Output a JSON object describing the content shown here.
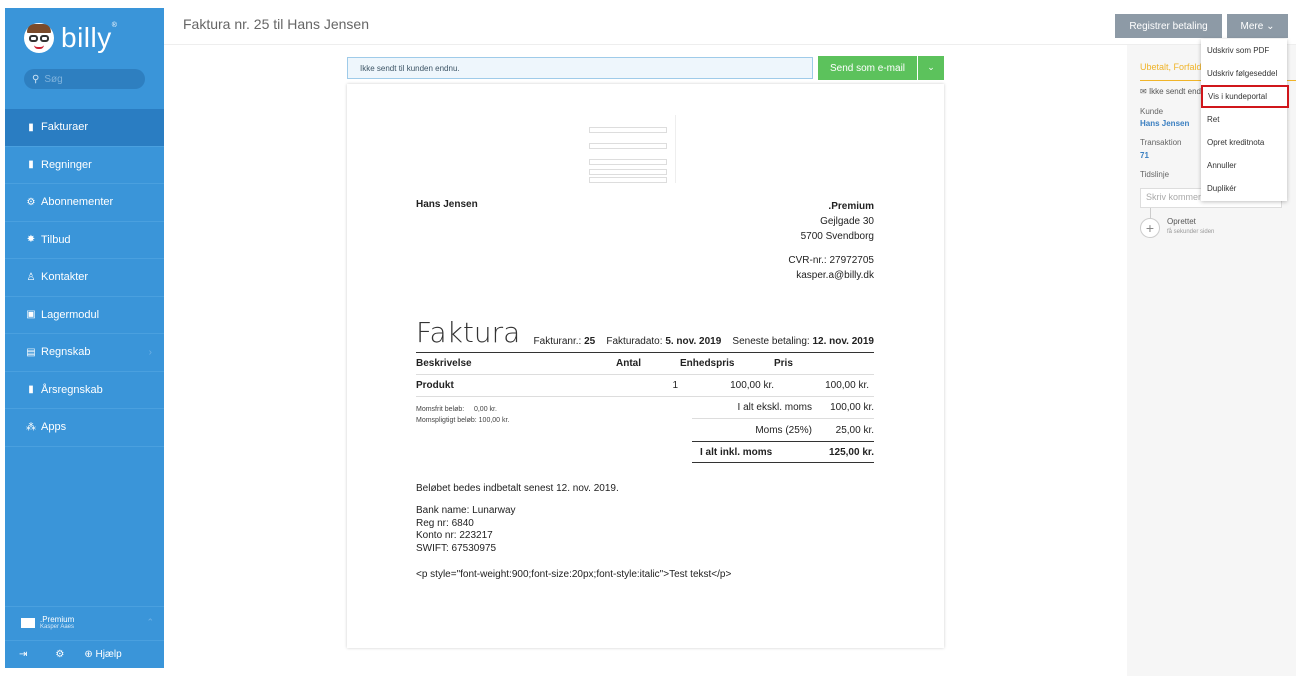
{
  "sidebar": {
    "logo": "billy",
    "logo_mark": "®",
    "search_placeholder": "Søg",
    "items": [
      {
        "label": "Fakturaer",
        "icon": "invoice-icon",
        "glyph": "▮"
      },
      {
        "label": "Regninger",
        "icon": "bill-icon",
        "glyph": "▮"
      },
      {
        "label": "Abonnementer",
        "icon": "subscription-icon",
        "glyph": "⚙"
      },
      {
        "label": "Tilbud",
        "icon": "quote-icon",
        "glyph": "✸"
      },
      {
        "label": "Kontakter",
        "icon": "contacts-icon",
        "glyph": "♙"
      },
      {
        "label": "Lagermodul",
        "icon": "inventory-icon",
        "glyph": "▣"
      },
      {
        "label": "Regnskab",
        "icon": "accounting-icon",
        "glyph": "▤"
      },
      {
        "label": "Årsregnskab",
        "icon": "annual-report-icon",
        "glyph": "▮"
      },
      {
        "label": "Apps",
        "icon": "apps-icon",
        "glyph": "⁂"
      }
    ],
    "org_name": ".Premium",
    "org_user": "Kasper Aaes",
    "help": "Hjælp"
  },
  "header": {
    "title": "Faktura nr. 25 til Hans Jensen",
    "register_payment": "Registrer betaling",
    "more": "Mere"
  },
  "notice": "Ikke sendt til kunden endnu.",
  "send_email": "Send som e-mail",
  "invoice": {
    "customer": "Hans Jensen",
    "company": {
      "name": ".Premium",
      "street": "Gejlgade 30",
      "city": "5700 Svendborg",
      "cvr": "CVR-nr.: 27972705",
      "email": "kasper.a@billy.dk"
    },
    "heading": "Faktura",
    "invoice_no_label": "Fakturanr.:",
    "invoice_no": "25",
    "date_label": "Fakturadato:",
    "date": "5. nov. 2019",
    "due_label": "Seneste betaling:",
    "due": "12. nov. 2019",
    "columns": [
      "Beskrivelse",
      "Antal",
      "Enhedspris",
      "Pris"
    ],
    "rows": [
      {
        "desc": "Produkt",
        "qty": "1",
        "unit": "100,00 kr.",
        "price": "100,00 kr."
      }
    ],
    "vat_free_label": "Momsfrit beløb:",
    "vat_free": "0,00 kr.",
    "vat_liable_label": "Momspligtigt beløb:",
    "vat_liable": "100,00 kr.",
    "totals": {
      "excl_label": "I alt ekskl. moms",
      "excl": "100,00 kr.",
      "vat_label": "Moms (25%)",
      "vat": "25,00 kr.",
      "incl_label": "I alt inkl. moms",
      "incl": "125,00 kr."
    },
    "pay_note": "Beløbet bedes indbetalt senest 12. nov. 2019.",
    "bank_lines": [
      "Bank name: Lunarway",
      "Reg nr: 6840",
      "Konto nr: 223217",
      "SWIFT: 67530975"
    ],
    "extra_text": "<p style=\"font-weight:900;font-size:20px;font-style:italic\">Test tekst</p>"
  },
  "right_panel": {
    "status": "Ubetalt, Forfalden",
    "sent": "Ikke sendt endnu",
    "customer_label": "Kunde",
    "customer": "Hans Jensen",
    "transaction_label": "Transaktion",
    "transaction": "71",
    "timeline_label": "Tidslinje",
    "comment_placeholder": "Skriv kommentar",
    "event": "Oprettet",
    "event_time": "få sekunder siden"
  },
  "dropdown": {
    "items": [
      "Udskriv som PDF",
      "Udskriv følgeseddel",
      "Vis i kundeportal",
      "Ret",
      "Opret kreditnota",
      "Annuller",
      "Duplikér"
    ]
  },
  "colors": {
    "sidebar": "#3a95d9",
    "active": "#2a7dc2",
    "send": "#5cc25c",
    "highlight": "#d0161b",
    "status": "#f0b429"
  }
}
